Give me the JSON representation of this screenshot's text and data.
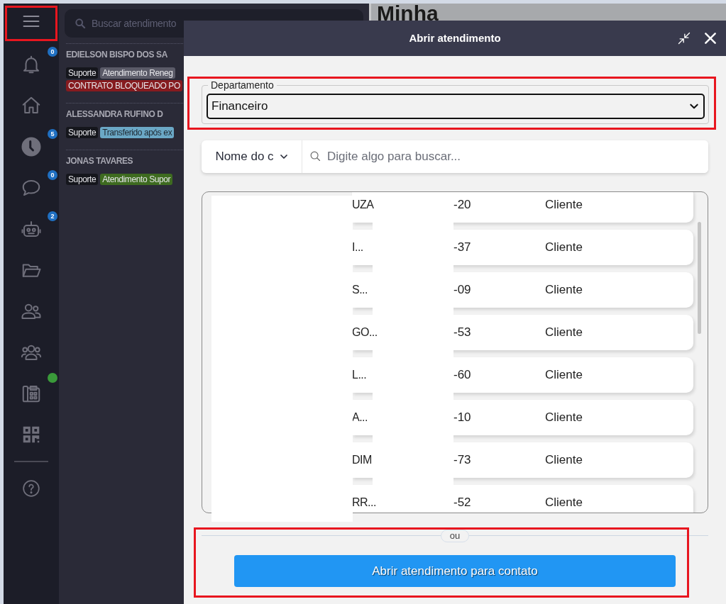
{
  "sidebar": {
    "badges": [
      "0",
      "5",
      "0",
      "2"
    ],
    "status_dot": {
      "color": "#3a9a3a"
    }
  },
  "conversations": {
    "search": {
      "placeholder": "Buscar atendimento"
    },
    "items": [
      {
        "name": "EDIELSON BISPO DOS SA",
        "tags": [
          {
            "label": "Suporte",
            "color": "#15161c"
          },
          {
            "label": "Atendimento Reneg",
            "color": "#5b5b68"
          },
          {
            "label": "CONTRATO BLOQUEADO PO",
            "color": "#861b1f"
          }
        ]
      },
      {
        "name": "ALESSANDRA RUFINO D",
        "tags": [
          {
            "label": "Suporte",
            "color": "#15161c"
          },
          {
            "label": "Transferido após ex",
            "color": "#6ba8c6"
          }
        ]
      },
      {
        "name": "JONAS TAVARES",
        "tags": [
          {
            "label": "Suporte",
            "color": "#15161c"
          },
          {
            "label": "Atendimento Supor",
            "color": "#3e6b20"
          }
        ]
      }
    ]
  },
  "main": {
    "heading": "Minha"
  },
  "modal": {
    "title": "Abrir atendimento",
    "department": {
      "label": "Departamento",
      "value": "Financeiro"
    },
    "search": {
      "filter": "Nome do c",
      "placeholder": "Digite algo para buscar..."
    },
    "contacts": [
      {
        "name": "UZA",
        "number": "-20",
        "type": "Cliente"
      },
      {
        "name": "I...",
        "number": "-37",
        "type": "Cliente"
      },
      {
        "name": "S...",
        "number": "-09",
        "type": "Cliente"
      },
      {
        "name": "GO...",
        "number": "-53",
        "type": "Cliente"
      },
      {
        "name": "L...",
        "number": "-60",
        "type": "Cliente"
      },
      {
        "name": "A...",
        "number": "-10",
        "type": "Cliente"
      },
      {
        "name": "DIM",
        "number": "-73",
        "type": "Cliente"
      },
      {
        "name": "RR...",
        "number": "-52",
        "type": "Cliente"
      }
    ],
    "separator": "ou",
    "button": "Abrir atendimento para contato"
  }
}
